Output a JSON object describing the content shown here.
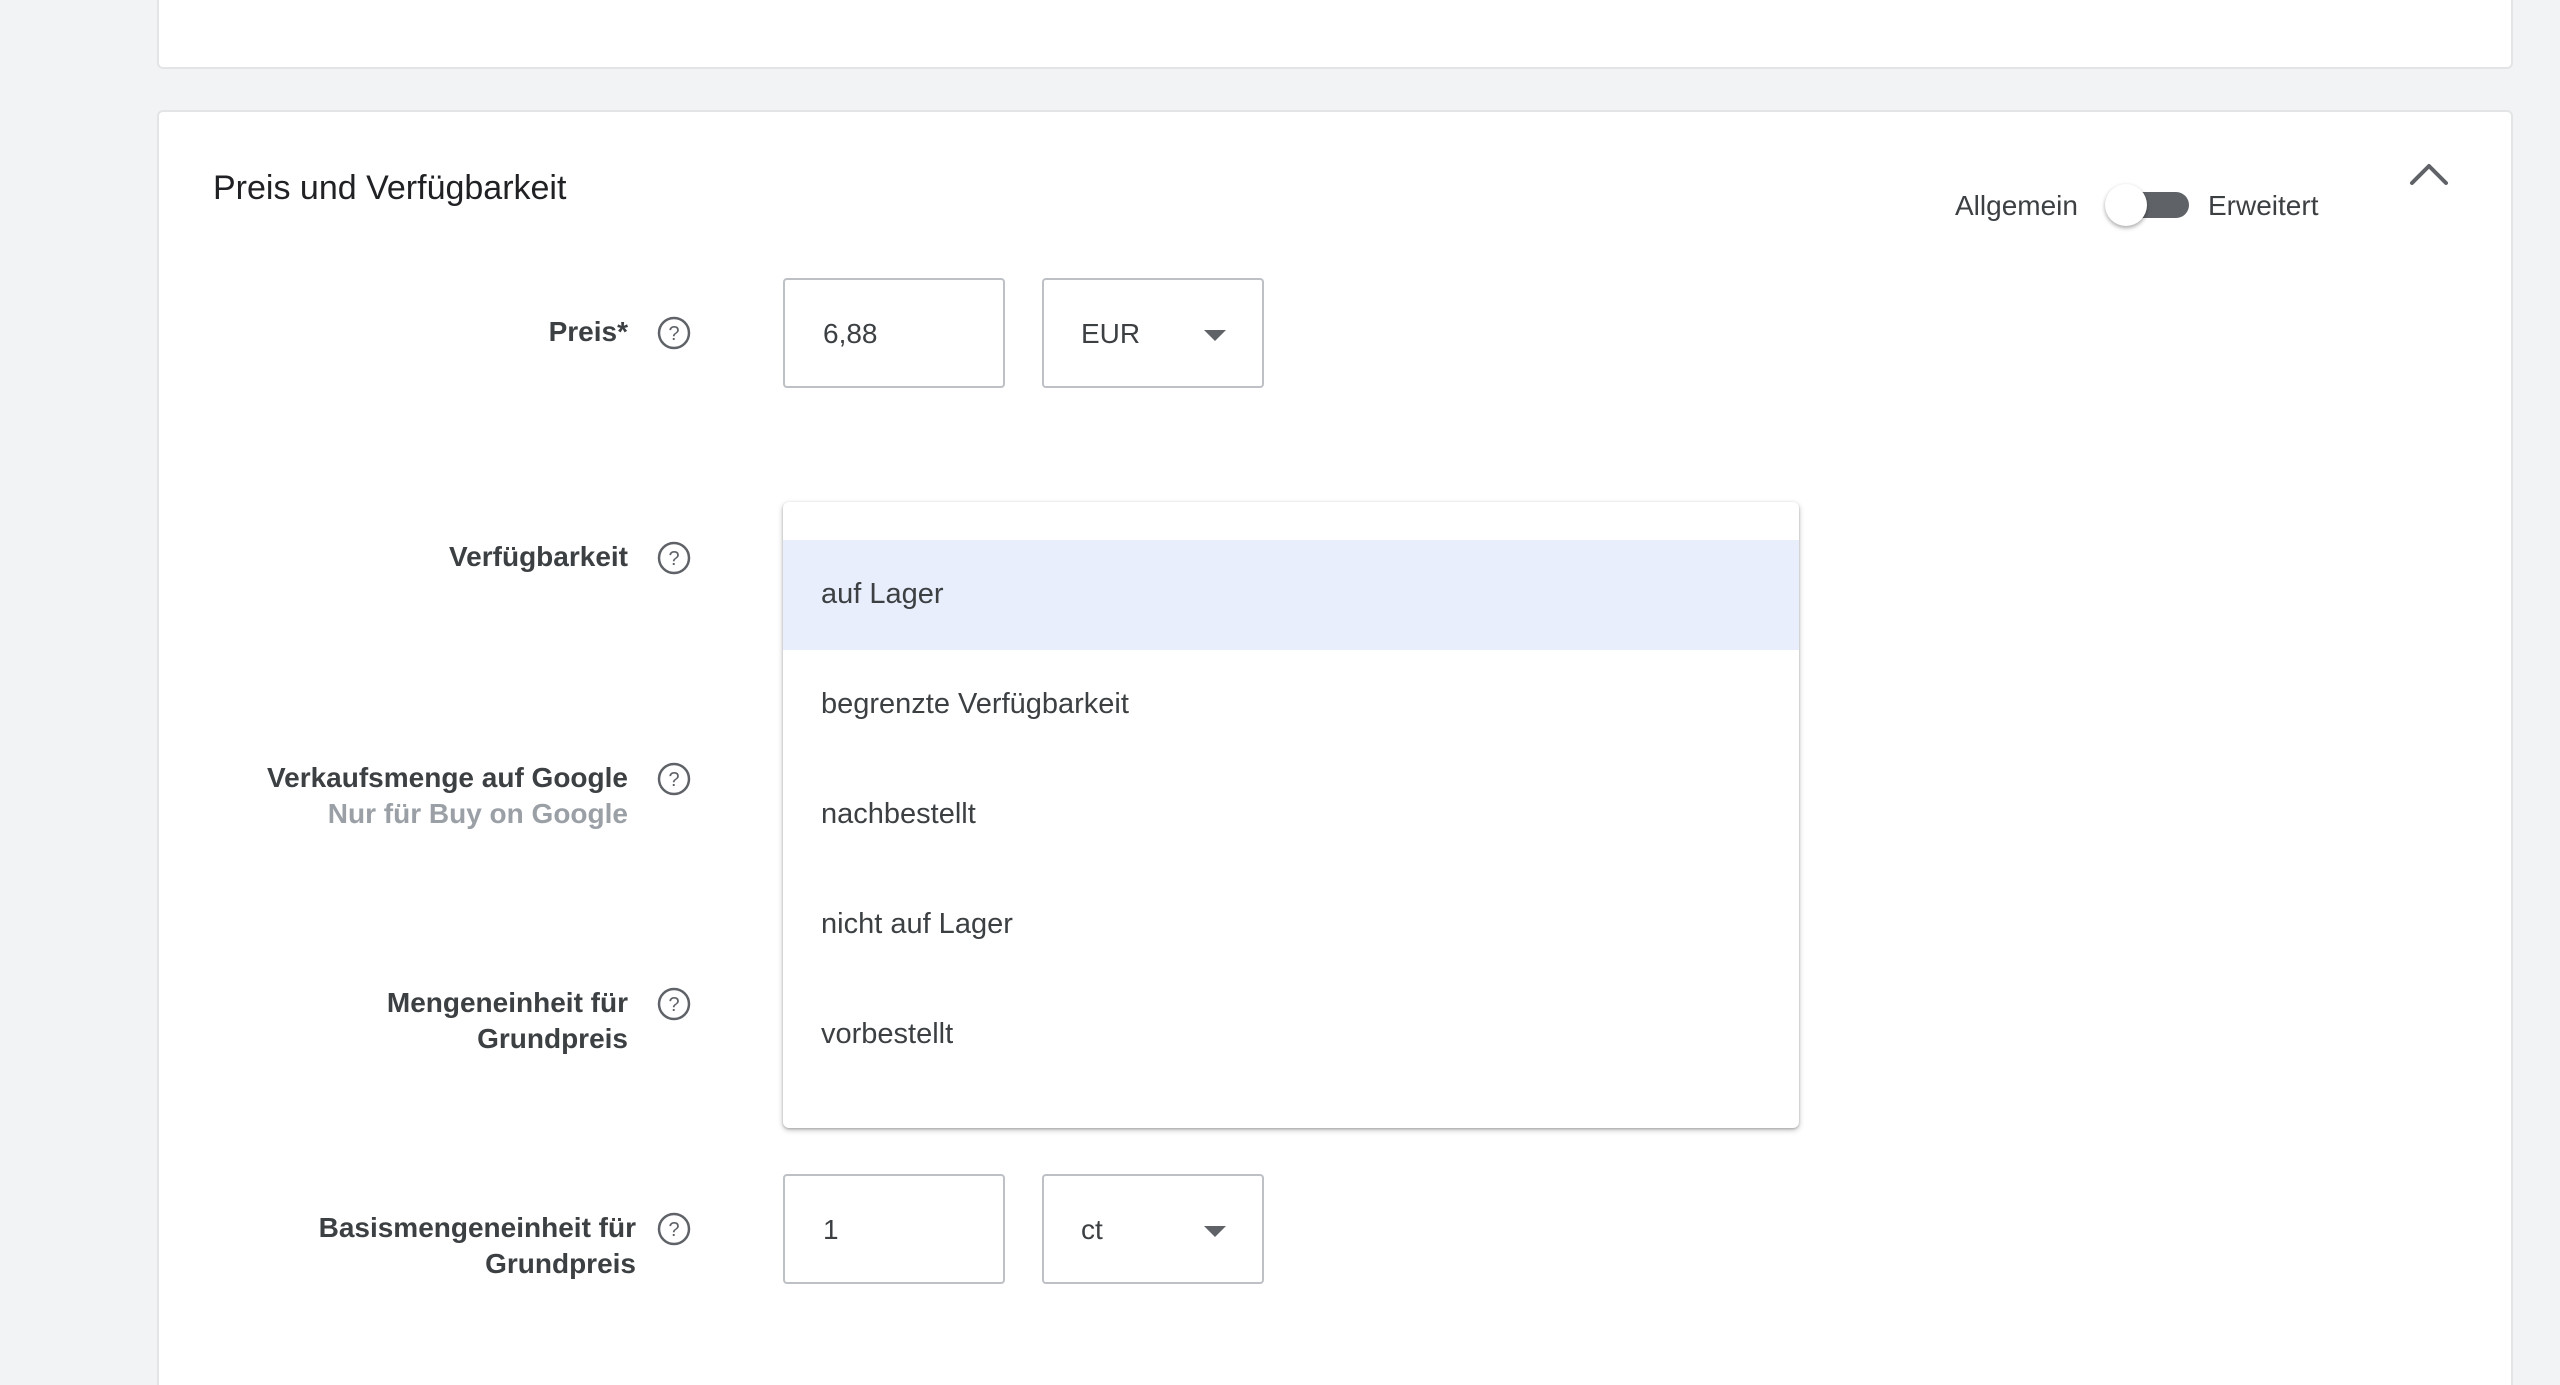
{
  "section": {
    "title": "Preis und Verfügbarkeit",
    "toggle_left": "Allgemein",
    "toggle_right": "Erweitert"
  },
  "price": {
    "label": "Preis*",
    "value": "6,88",
    "currency": "EUR"
  },
  "availability": {
    "label": "Verfügbarkeit",
    "options": [
      "auf Lager",
      "begrenzte Verfügbarkeit",
      "nachbestellt",
      "nicht auf Lager",
      "vorbestellt"
    ],
    "selected": "auf Lager"
  },
  "sales_quantity": {
    "label": "Verkaufsmenge auf Google",
    "sublabel": "Nur für Buy on Google"
  },
  "unit_pricing": {
    "label_line1": "Mengeneinheit für",
    "label_line2": "Grundpreis"
  },
  "base_unit": {
    "label_line1": "Basismengeneinheit für",
    "label_line2": "Grundpreis",
    "value": "1",
    "unit": "ct"
  },
  "colors": {
    "highlight": "#e8eefc",
    "toggle_track": "#5f6368"
  }
}
